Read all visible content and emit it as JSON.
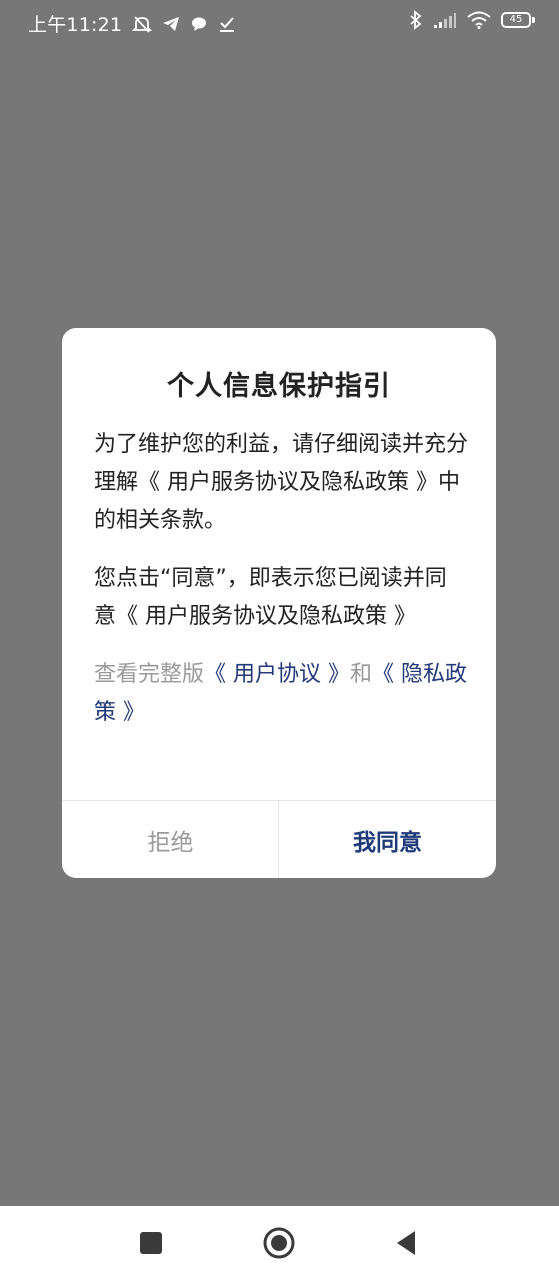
{
  "status_bar": {
    "time": "上午11:21",
    "battery_level": "45",
    "left_icons": [
      "mute-alarm-icon",
      "telegram-icon",
      "chat-bubble-icon",
      "download-check-icon"
    ],
    "right_icons": [
      "bluetooth-icon",
      "signal-icon",
      "wifi-icon",
      "battery-icon"
    ]
  },
  "dialog": {
    "title": "个人信息保护指引",
    "paragraph1": "为了维护您的利益，请仔细阅读并充分理解《 用户服务协议及隐私政策 》中的相关条款。",
    "paragraph2": "您点击“同意”，即表示您已阅读并同意《 用户服务协议及隐私政策 》",
    "view_prefix": "查看完整版",
    "user_agreement_link": "《 用户协议 》",
    "and_text": "和",
    "privacy_policy_link": "《 隐私政策 》",
    "refuse_button": "拒绝",
    "agree_button": "我同意"
  },
  "nav_bar": {
    "buttons": [
      "recents",
      "home",
      "back"
    ]
  },
  "colors": {
    "overlay": "#777777",
    "dialog_bg": "#ffffff",
    "link": "#233a7a",
    "agree": "#1f3a78",
    "muted": "#9a9a9a"
  }
}
